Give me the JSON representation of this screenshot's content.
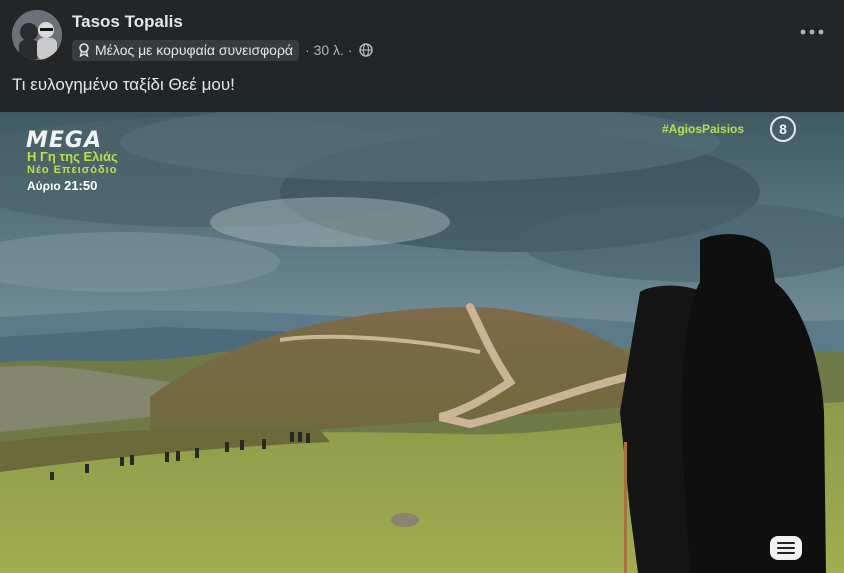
{
  "post": {
    "author": "Tasos Topalis",
    "badge": "Μέλος με κορυφαία συνεισφορά",
    "timestamp": "· 30 λ. ·",
    "text": "Τι ευλογημένο ταξίδι Θεέ μου!"
  },
  "icons": {
    "badge": "award-icon",
    "audience": "globe-icon",
    "more": "more-options-icon",
    "captions": "closed-captions-icon"
  },
  "video_overlay": {
    "channel_logo": "MEGA",
    "show_title": "Η Γη της Ελιάς",
    "show_subtitle": "Νέο Επεισόδιο",
    "air_day": "Αύριο",
    "air_time": "21:50",
    "hashtag": "#AgiosPaisios",
    "rating": "8"
  },
  "colors": {
    "background": "#242526",
    "text_primary": "#e4e6eb",
    "text_secondary": "#b0b3b8",
    "overlay_accent": "#b8e04a"
  }
}
